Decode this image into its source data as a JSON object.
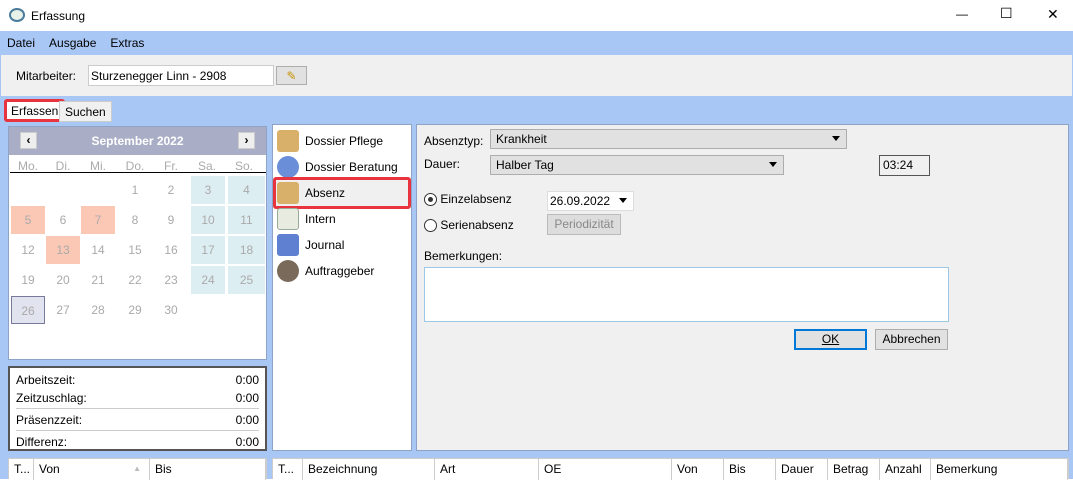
{
  "window": {
    "title": "Erfassung",
    "minimize": "—",
    "maximize": "☐",
    "close": "✕"
  },
  "menu": [
    "Datei",
    "Ausgabe",
    "Extras"
  ],
  "employee": {
    "label": "Mitarbeiter:",
    "value": "Sturzenegger Linn - 2908"
  },
  "tabs": [
    "Erfassen",
    "Suchen"
  ],
  "calendar": {
    "title": "September 2022",
    "prev": "‹",
    "next": "›",
    "weekdays": [
      "Mo.",
      "Di.",
      "Mi.",
      "Do.",
      "Fr.",
      "Sa.",
      "So."
    ],
    "weeks": [
      [
        "",
        "",
        "",
        "1",
        "2",
        "3",
        "4"
      ],
      [
        "5",
        "6",
        "7",
        "8",
        "9",
        "10",
        "11"
      ],
      [
        "12",
        "13",
        "14",
        "15",
        "16",
        "17",
        "18"
      ],
      [
        "19",
        "20",
        "21",
        "22",
        "23",
        "24",
        "25"
      ],
      [
        "26",
        "27",
        "28",
        "29",
        "30",
        "",
        ""
      ]
    ],
    "highlighted_days": [
      "5",
      "7",
      "13"
    ],
    "selected_day": "26"
  },
  "stats": [
    {
      "label": "Arbeitszeit:",
      "value": "0:00"
    },
    {
      "label": "Zeitzuschlag:",
      "value": "0:00"
    },
    {
      "label": "Präsenzzeit:",
      "value": "0:00"
    },
    {
      "label": "Differenz:",
      "value": "0:00"
    }
  ],
  "categories": [
    {
      "label": "Dossier Pflege",
      "icon": "folder-person-icon"
    },
    {
      "label": "Dossier Beratung",
      "icon": "people-icon"
    },
    {
      "label": "Absenz",
      "icon": "folder-house-icon"
    },
    {
      "label": "Intern",
      "icon": "document-icon"
    },
    {
      "label": "Journal",
      "icon": "journal-pen-icon"
    },
    {
      "label": "Auftraggeber",
      "icon": "clients-icon"
    }
  ],
  "form": {
    "absenztyp_label": "Absenztyp:",
    "absenztyp": "Krankheit",
    "dauer_label": "Dauer:",
    "dauer": "Halber Tag",
    "time": "03:24",
    "einzel": "Einzelabsenz",
    "serien": "Serienabsenz",
    "date": "26.09.2022",
    "periodizitaet": "Periodizität",
    "bemerkungen_label": "Bemerkungen:",
    "bemerkungen": "",
    "ok": "OK",
    "cancel": "Abbrechen"
  },
  "left_grid_headers": [
    "T...",
    "Von",
    "Bis"
  ],
  "main_grid_headers": [
    "T...",
    "Bezeichnung",
    "Art",
    "OE",
    "Von",
    "Bis",
    "Dauer",
    "Betrag",
    "Anzahl",
    "Bemerkung"
  ],
  "colors": {
    "accent": "#a9c7f5",
    "highlight_box": "#e8343f",
    "holiday": "#fcc8b6",
    "weekend": "#ddeef3"
  }
}
